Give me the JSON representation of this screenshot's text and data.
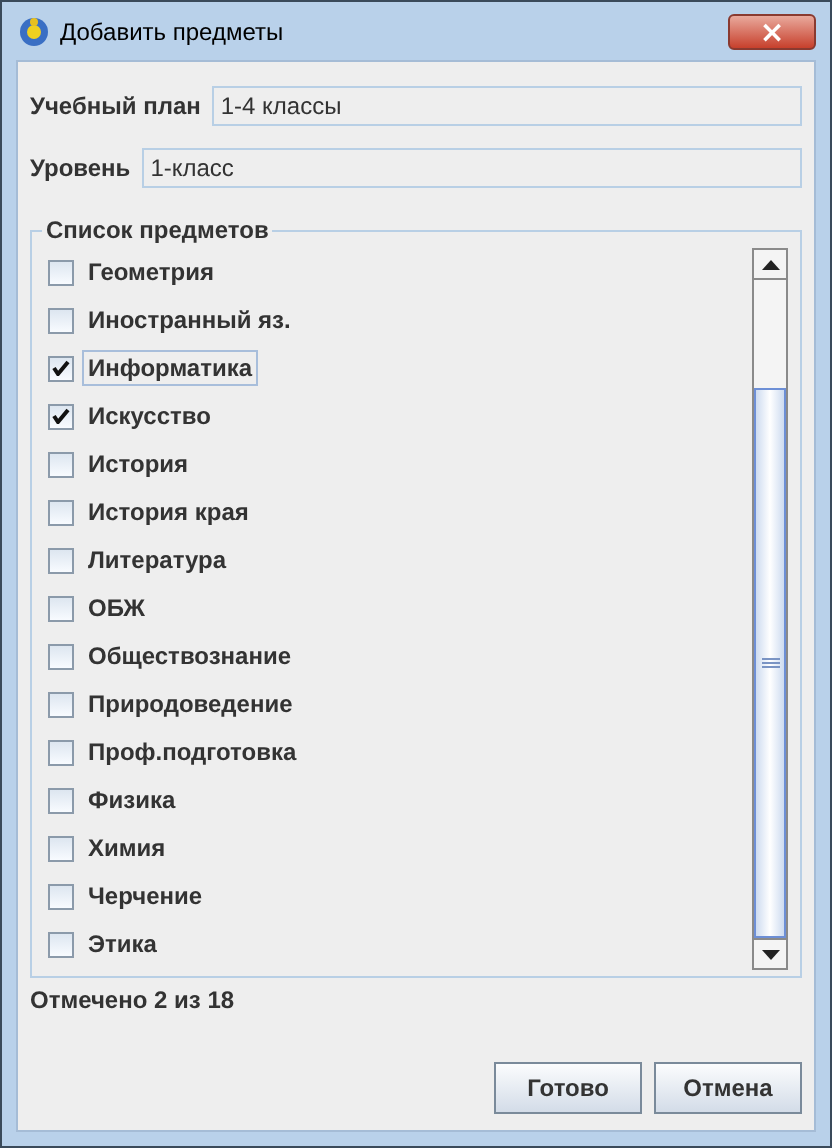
{
  "window": {
    "title": "Добавить предметы",
    "close": "×"
  },
  "fields": [
    {
      "label": "Учебный план",
      "value": "1-4 классы"
    },
    {
      "label": "Уровень",
      "value": "1-класс"
    }
  ],
  "subjects": {
    "title": "Список предметов",
    "items": [
      {
        "label": "Геометрия",
        "checked": false,
        "focused": false
      },
      {
        "label": "Иностранный яз.",
        "checked": false,
        "focused": false
      },
      {
        "label": "Информатика",
        "checked": true,
        "focused": true
      },
      {
        "label": "Искусство",
        "checked": true,
        "focused": false
      },
      {
        "label": "История",
        "checked": false,
        "focused": false
      },
      {
        "label": "История края",
        "checked": false,
        "focused": false
      },
      {
        "label": "Литература",
        "checked": false,
        "focused": false
      },
      {
        "label": "ОБЖ",
        "checked": false,
        "focused": false
      },
      {
        "label": "Обществознание",
        "checked": false,
        "focused": false
      },
      {
        "label": "Природоведение",
        "checked": false,
        "focused": false
      },
      {
        "label": "Проф.подготовка",
        "checked": false,
        "focused": false
      },
      {
        "label": "Физика",
        "checked": false,
        "focused": false
      },
      {
        "label": "Химия",
        "checked": false,
        "focused": false
      },
      {
        "label": "Черчение",
        "checked": false,
        "focused": false
      },
      {
        "label": "Этика",
        "checked": false,
        "focused": false
      }
    ]
  },
  "status": "Отмечено 2 из 18",
  "buttons": [
    "Готово",
    "Отмена"
  ]
}
